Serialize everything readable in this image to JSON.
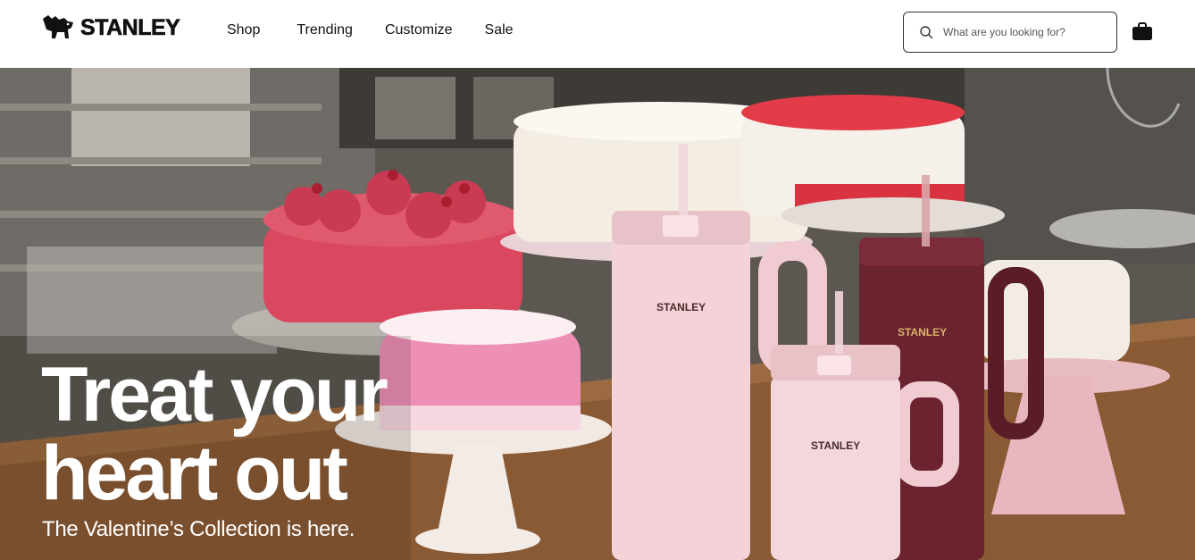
{
  "header": {
    "logo_text": "STANLEY",
    "nav": [
      {
        "label": "Shop"
      },
      {
        "label": "Trending"
      },
      {
        "label": "Customize"
      },
      {
        "label": "Sale"
      }
    ],
    "search": {
      "placeholder": "What are you looking for?"
    },
    "cart_icon": "shopping-bag-icon"
  },
  "hero": {
    "title": "Treat your\nheart out",
    "subtitle": "The Valentine’s Collection is here.",
    "cup_brand": "STANLEY"
  },
  "colors": {
    "cake_red": "#d9485e",
    "cake_pink": "#ee8fb6",
    "cup_pink": "#f3d3d8",
    "cup_maroon": "#6b2330",
    "counter": "#8a5a34"
  }
}
